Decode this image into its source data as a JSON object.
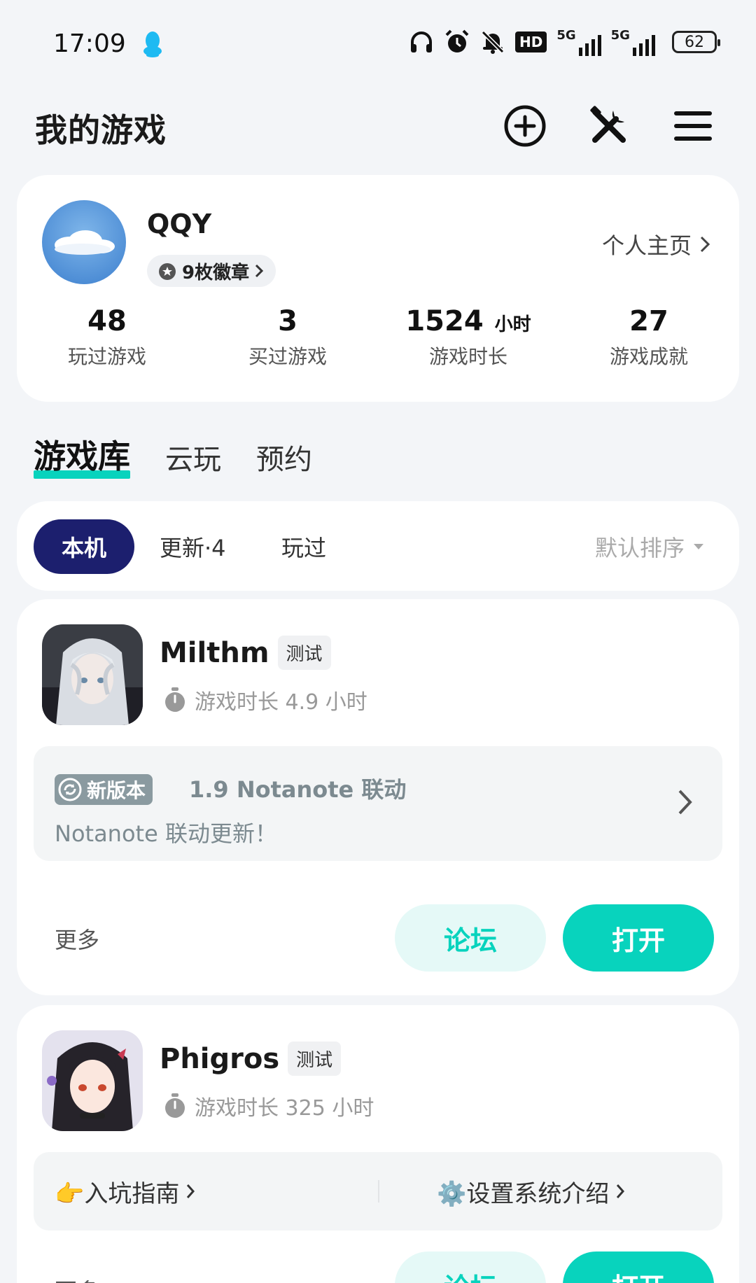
{
  "status_bar": {
    "time": "17:09",
    "network_1": "5G",
    "network_2": "5G",
    "hd_label": "HD",
    "battery": "62"
  },
  "header": {
    "title": "我的游戏"
  },
  "profile": {
    "username": "QQY",
    "badges": "9枚徽章",
    "home_link": "个人主页",
    "stats": [
      {
        "value": "48",
        "unit": "",
        "label": "玩过游戏"
      },
      {
        "value": "3",
        "unit": "",
        "label": "买过游戏"
      },
      {
        "value": "1524",
        "unit": "小时",
        "label": "游戏时长"
      },
      {
        "value": "27",
        "unit": "",
        "label": "游戏成就"
      }
    ]
  },
  "tabs": [
    "游戏库",
    "云玩",
    "预约"
  ],
  "filters": {
    "local": "本机",
    "update": "更新·4",
    "played": "玩过",
    "sort": "默认排序"
  },
  "games": [
    {
      "name": "Milthm",
      "tag": "测试",
      "playtime": "游戏时长 4.9 小时",
      "update_badge": "新版本",
      "update_title": "1.9 Notanote 联动",
      "update_desc": "Notanote 联动更新！",
      "more": "更多",
      "forum": "论坛",
      "open": "打开"
    },
    {
      "name": "Phigros",
      "tag": "测试",
      "playtime": "游戏时长 325 小时",
      "guide_1": "👉入坑指南",
      "guide_2": "⚙️设置系统介绍",
      "more": "更多",
      "forum": "论坛",
      "open": "打开"
    }
  ],
  "colors": {
    "accent": "#08d3bd",
    "chip_active": "#1c1f6e",
    "background": "#f3f5f8"
  }
}
